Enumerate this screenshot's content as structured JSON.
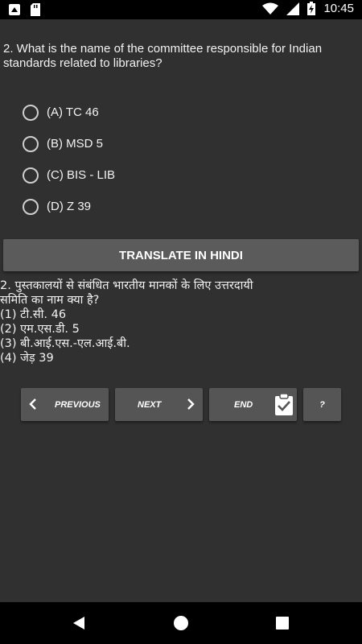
{
  "status_bar": {
    "time": "10:45",
    "icons": [
      "notification-icon",
      "sd-card-icon",
      "wifi-icon",
      "signal-icon",
      "battery-charging-icon"
    ]
  },
  "question": {
    "text": "2. What is the name of the committee responsible for Indian standards related to libraries?"
  },
  "options": [
    {
      "label": "(A) TC 46"
    },
    {
      "label": "(B) MSD 5"
    },
    {
      "label": "(C) BIS - LIB"
    },
    {
      "label": "(D) Z 39"
    }
  ],
  "translate_button": {
    "label": "TRANSLATE IN HINDI"
  },
  "hindi": {
    "lines": [
      "2. पुस्तकालयों से संबंधित भारतीय मानकों के लिए उत्तरदायी",
      "समिति का नाम क्या है?",
      "(1) टी.सी. 46",
      "(2) एम.एस.डी. 5",
      "(3) बी.आई.एस.-एल.आई.बी.",
      "(4) जेड़ 39"
    ]
  },
  "nav_buttons": {
    "previous": "PREVIOUS",
    "next": "NEXT",
    "end": "END",
    "help": "?"
  },
  "colors": {
    "background": "#303030",
    "button": "#555555",
    "translate_button": "#5b5b5b",
    "system_bar": "#000000"
  }
}
